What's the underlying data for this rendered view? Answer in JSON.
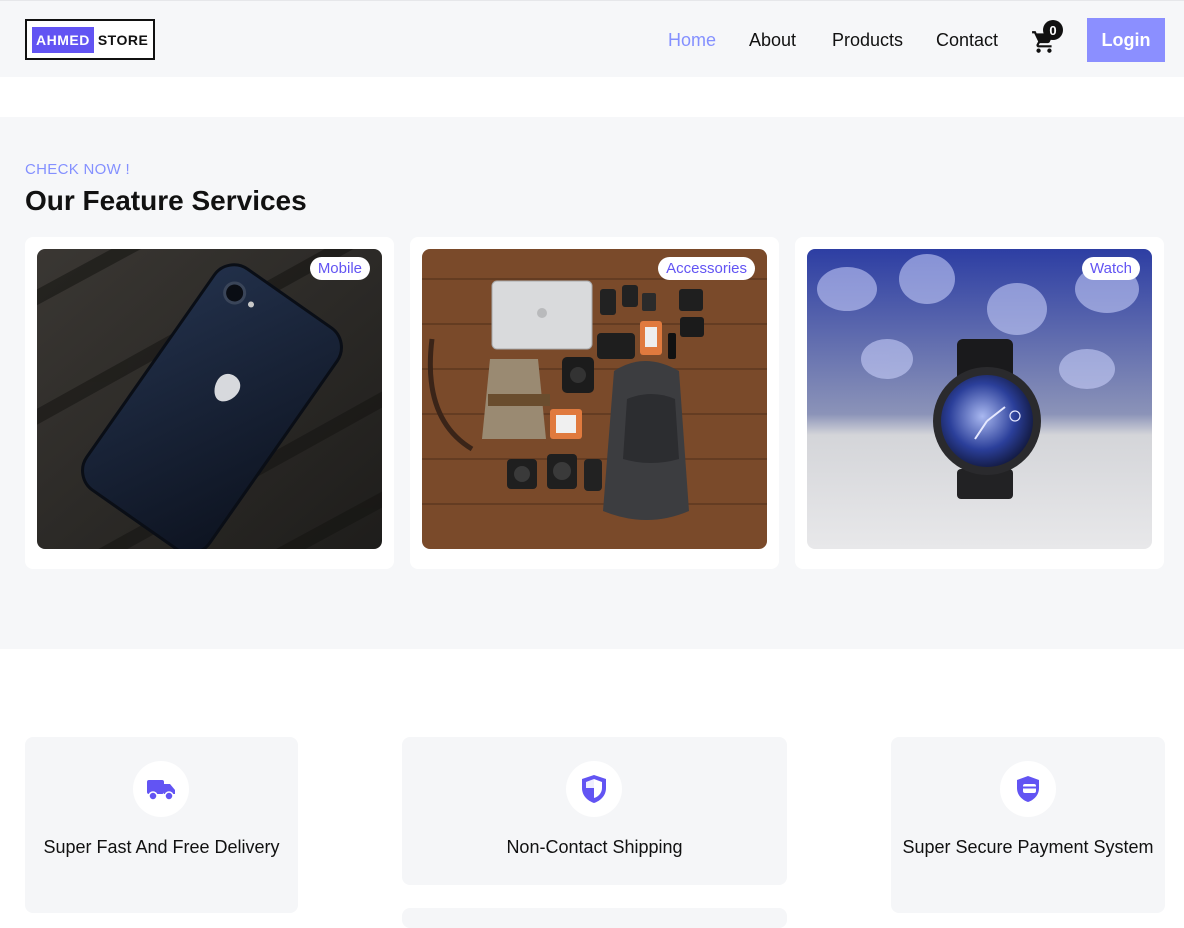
{
  "brand": {
    "badge": "AHMED",
    "text": "STORE",
    "accent": "#6254f3"
  },
  "nav": {
    "items": [
      {
        "label": "Home",
        "active": true
      },
      {
        "label": "About",
        "active": false
      },
      {
        "label": "Products",
        "active": false
      },
      {
        "label": "Contact",
        "active": false
      }
    ],
    "cart_count": "0",
    "cart_icon": "cart-icon",
    "login_label": "Login"
  },
  "featured": {
    "kicker": "CHECK NOW !",
    "title": "Our Feature Services",
    "cards": [
      {
        "tag": "Mobile"
      },
      {
        "tag": "Accessories"
      },
      {
        "tag": "Watch"
      }
    ]
  },
  "features": [
    {
      "icon": "truck-icon",
      "label": "Super Fast And Free Delivery"
    },
    {
      "icon": "shield-icon",
      "label": "Non-Contact Shipping"
    },
    {
      "icon": "secure-payment-icon",
      "label": "Super Secure Payment System"
    }
  ],
  "colors": {
    "accent": "#8490ff",
    "button": "#8b8fff",
    "section_bg": "#f6f7f9"
  }
}
